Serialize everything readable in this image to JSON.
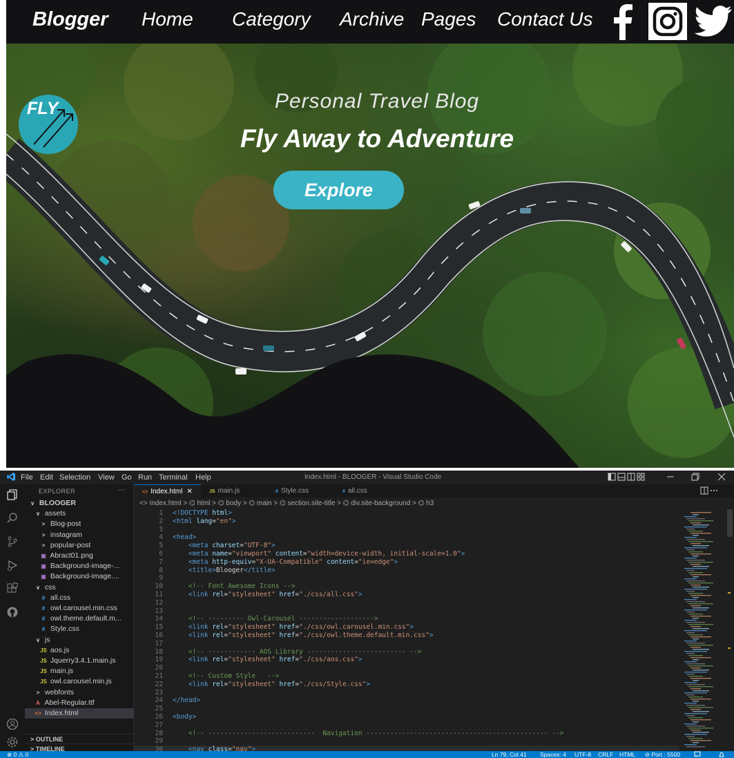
{
  "website": {
    "nav": {
      "brand": "Blogger",
      "links": [
        "Home",
        "Category",
        "Archive",
        "Pages",
        "Contact Us"
      ]
    },
    "logo_text": "FLY",
    "hero": {
      "subtitle": "Personal  Travel  Blog",
      "title": "Fly Away to Adventure",
      "button_label": "Explore"
    },
    "colors": {
      "accent": "#3ab3c6",
      "nav_bg": "#121214"
    }
  },
  "vscode": {
    "menu": [
      "File",
      "Edit",
      "Selection",
      "View",
      "Go",
      "Run",
      "Terminal",
      "Help"
    ],
    "window_title": "Index.html - BLOOGER - Visual Studio Code",
    "explorer": {
      "header": "EXPLORER",
      "dots": "···",
      "items": [
        {
          "label": "BLOOGER",
          "prefix": "∨",
          "icon": "",
          "icon_color": "#cccccc"
        },
        {
          "label": "assets",
          "prefix": "∨",
          "icon": "",
          "icon_color": "#cccccc"
        },
        {
          "label": "Blog-post",
          "prefix": ">",
          "icon": "",
          "icon_color": "#cccccc"
        },
        {
          "label": "instagram",
          "prefix": ">",
          "icon": "",
          "icon_color": "#cccccc"
        },
        {
          "label": "popular-post",
          "prefix": ">",
          "icon": "",
          "icon_color": "#cccccc"
        },
        {
          "label": "Abract01.png",
          "prefix": "",
          "icon": "▣",
          "icon_color": "#a074c4"
        },
        {
          "label": "Background-image-...",
          "prefix": "",
          "icon": "▣",
          "icon_color": "#a074c4"
        },
        {
          "label": "Background-image....",
          "prefix": "",
          "icon": "▣",
          "icon_color": "#a074c4"
        },
        {
          "label": "css",
          "prefix": "∨",
          "icon": "",
          "icon_color": "#cccccc"
        },
        {
          "label": "all.css",
          "prefix": "",
          "icon": "#",
          "icon_color": "#42a5f5"
        },
        {
          "label": "owl.carousel.min.css",
          "prefix": "",
          "icon": "#",
          "icon_color": "#42a5f5"
        },
        {
          "label": "owl.theme.default.m...",
          "prefix": "",
          "icon": "#",
          "icon_color": "#42a5f5"
        },
        {
          "label": "Style.css",
          "prefix": "",
          "icon": "#",
          "icon_color": "#42a5f5"
        },
        {
          "label": "js",
          "prefix": "∨",
          "icon": "",
          "icon_color": "#cccccc"
        },
        {
          "label": "aos.js",
          "prefix": "",
          "icon": "JS",
          "icon_color": "#cbcb41"
        },
        {
          "label": "Jquerry3.4.1.main.js",
          "prefix": "",
          "icon": "JS",
          "icon_color": "#cbcb41"
        },
        {
          "label": "main.js",
          "prefix": "",
          "icon": "JS",
          "icon_color": "#cbcb41"
        },
        {
          "label": "owl.carousel.min.js",
          "prefix": "",
          "icon": "JS",
          "icon_color": "#cbcb41"
        },
        {
          "label": "webfonts",
          "prefix": ">",
          "icon": "",
          "icon_color": "#cccccc"
        },
        {
          "label": "Abel-Regular.ttf",
          "prefix": "",
          "icon": "A",
          "icon_color": "#e06c75"
        },
        {
          "label": "Index.html",
          "prefix": "",
          "icon": "<>",
          "icon_color": "#e37933"
        }
      ],
      "outline": "OUTLINE",
      "timeline": "TIMELINE"
    },
    "tabs": [
      {
        "label": "Index.html",
        "icon": "<>",
        "icon_color": "#e37933",
        "active": true,
        "close": "✕"
      },
      {
        "label": "main.js",
        "icon": "JS",
        "icon_color": "#cbcb41",
        "active": false,
        "close": ""
      },
      {
        "label": "Style.css",
        "icon": "#",
        "icon_color": "#42a5f5",
        "active": false,
        "close": ""
      },
      {
        "label": "all.css",
        "icon": "#",
        "icon_color": "#42a5f5",
        "active": false,
        "close": ""
      }
    ],
    "breadcrumb": "<> Index.html > ⌬ html > ⌬ body > ⌬ main > ⌬ section.site-title > ⌬ div.site-background > ⌬ h3",
    "code_lines": [
      [
        {
          "t": "<!DOCTYPE ",
          "c": "tag"
        },
        {
          "t": "html",
          "c": "attr"
        },
        {
          "t": ">",
          "c": "tag"
        }
      ],
      [
        {
          "t": "<html ",
          "c": "tag"
        },
        {
          "t": "lang",
          "c": "attr"
        },
        {
          "t": "=",
          "c": "txt"
        },
        {
          "t": "\"en\"",
          "c": "str"
        },
        {
          "t": ">",
          "c": "tag"
        }
      ],
      [],
      [
        {
          "t": "<head>",
          "c": "tag"
        }
      ],
      [
        {
          "t": "    <meta ",
          "c": "tag"
        },
        {
          "t": "charset",
          "c": "attr"
        },
        {
          "t": "=",
          "c": "txt"
        },
        {
          "t": "\"UTF-8\"",
          "c": "str"
        },
        {
          "t": ">",
          "c": "tag"
        }
      ],
      [
        {
          "t": "    <meta ",
          "c": "tag"
        },
        {
          "t": "name",
          "c": "attr"
        },
        {
          "t": "=",
          "c": "txt"
        },
        {
          "t": "\"viewport\" ",
          "c": "str"
        },
        {
          "t": "content",
          "c": "attr"
        },
        {
          "t": "=",
          "c": "txt"
        },
        {
          "t": "\"width=device-width, initial-scale=1.0\"",
          "c": "str"
        },
        {
          "t": ">",
          "c": "tag"
        }
      ],
      [
        {
          "t": "    <meta ",
          "c": "tag"
        },
        {
          "t": "http-equiv",
          "c": "attr"
        },
        {
          "t": "=",
          "c": "txt"
        },
        {
          "t": "\"X-UA-Compatible\" ",
          "c": "str"
        },
        {
          "t": "content",
          "c": "attr"
        },
        {
          "t": "=",
          "c": "txt"
        },
        {
          "t": "\"ie=edge\"",
          "c": "str"
        },
        {
          "t": ">",
          "c": "tag"
        }
      ],
      [
        {
          "t": "    <title>",
          "c": "tag"
        },
        {
          "t": "Blooger",
          "c": "txt"
        },
        {
          "t": "</title>",
          "c": "tag"
        }
      ],
      [],
      [
        {
          "t": "    <!-- Font Awesome Icons -->",
          "c": "com"
        }
      ],
      [
        {
          "t": "    <link ",
          "c": "tag"
        },
        {
          "t": "rel",
          "c": "attr"
        },
        {
          "t": "=",
          "c": "txt"
        },
        {
          "t": "\"stylesheet\" ",
          "c": "str"
        },
        {
          "t": "href",
          "c": "attr"
        },
        {
          "t": "=",
          "c": "txt"
        },
        {
          "t": "\"./css/all.css\"",
          "c": "str"
        },
        {
          "t": ">",
          "c": "tag"
        }
      ],
      [],
      [],
      [
        {
          "t": "    <!-- --------- Owl-Carousel ------------------->",
          "c": "com"
        }
      ],
      [
        {
          "t": "    <link ",
          "c": "tag"
        },
        {
          "t": "rel",
          "c": "attr"
        },
        {
          "t": "=",
          "c": "txt"
        },
        {
          "t": "\"stylesheet\" ",
          "c": "str"
        },
        {
          "t": "href",
          "c": "attr"
        },
        {
          "t": "=",
          "c": "txt"
        },
        {
          "t": "\"./css/owl.carousel.min.css\"",
          "c": "str"
        },
        {
          "t": ">",
          "c": "tag"
        }
      ],
      [
        {
          "t": "    <link ",
          "c": "tag"
        },
        {
          "t": "rel",
          "c": "attr"
        },
        {
          "t": "=",
          "c": "txt"
        },
        {
          "t": "\"stylesheet\" ",
          "c": "str"
        },
        {
          "t": "href",
          "c": "attr"
        },
        {
          "t": "=",
          "c": "txt"
        },
        {
          "t": "\"./css/owl.theme.default.min.css\"",
          "c": "str"
        },
        {
          "t": ">",
          "c": "tag"
        }
      ],
      [],
      [
        {
          "t": "    <!-- ------------ AOS Library ------------------------- -->",
          "c": "com"
        }
      ],
      [
        {
          "t": "    <link ",
          "c": "tag"
        },
        {
          "t": "rel",
          "c": "attr"
        },
        {
          "t": "=",
          "c": "txt"
        },
        {
          "t": "\"stylesheet\" ",
          "c": "str"
        },
        {
          "t": "href",
          "c": "attr"
        },
        {
          "t": "=",
          "c": "txt"
        },
        {
          "t": "\"./css/aos.css\"",
          "c": "str"
        },
        {
          "t": ">",
          "c": "tag"
        }
      ],
      [],
      [
        {
          "t": "    <!-- Custom Style   -->",
          "c": "com"
        }
      ],
      [
        {
          "t": "    <link ",
          "c": "tag"
        },
        {
          "t": "rel",
          "c": "attr"
        },
        {
          "t": "=",
          "c": "txt"
        },
        {
          "t": "\"stylesheet\" ",
          "c": "str"
        },
        {
          "t": "href",
          "c": "attr"
        },
        {
          "t": "=",
          "c": "txt"
        },
        {
          "t": "\"./css/Style.css\"",
          "c": "str"
        },
        {
          "t": ">",
          "c": "tag"
        }
      ],
      [],
      [
        {
          "t": "</head>",
          "c": "tag"
        }
      ],
      [],
      [
        {
          "t": "<body>",
          "c": "tag"
        }
      ],
      [],
      [
        {
          "t": "    <!-- ---------------------------  Navigation ---------------------------------------------- -->",
          "c": "com"
        }
      ],
      [],
      [
        {
          "t": "    <nav ",
          "c": "tag"
        },
        {
          "t": "class",
          "c": "attr"
        },
        {
          "t": "=",
          "c": "txt"
        },
        {
          "t": "\"nav\"",
          "c": "str"
        },
        {
          "t": ">",
          "c": "tag"
        }
      ]
    ],
    "status": {
      "left": "⊗ 0 ⚠ 0",
      "position": "Ln 79, Col 41",
      "spaces": "Spaces: 4",
      "encoding": "UTF-8",
      "eol": "CRLF",
      "language": "HTML",
      "port": "⊘ Port : 5500"
    },
    "colors": {
      "status_bar": "#007acc",
      "editor_bg": "#1f1f1f"
    }
  }
}
